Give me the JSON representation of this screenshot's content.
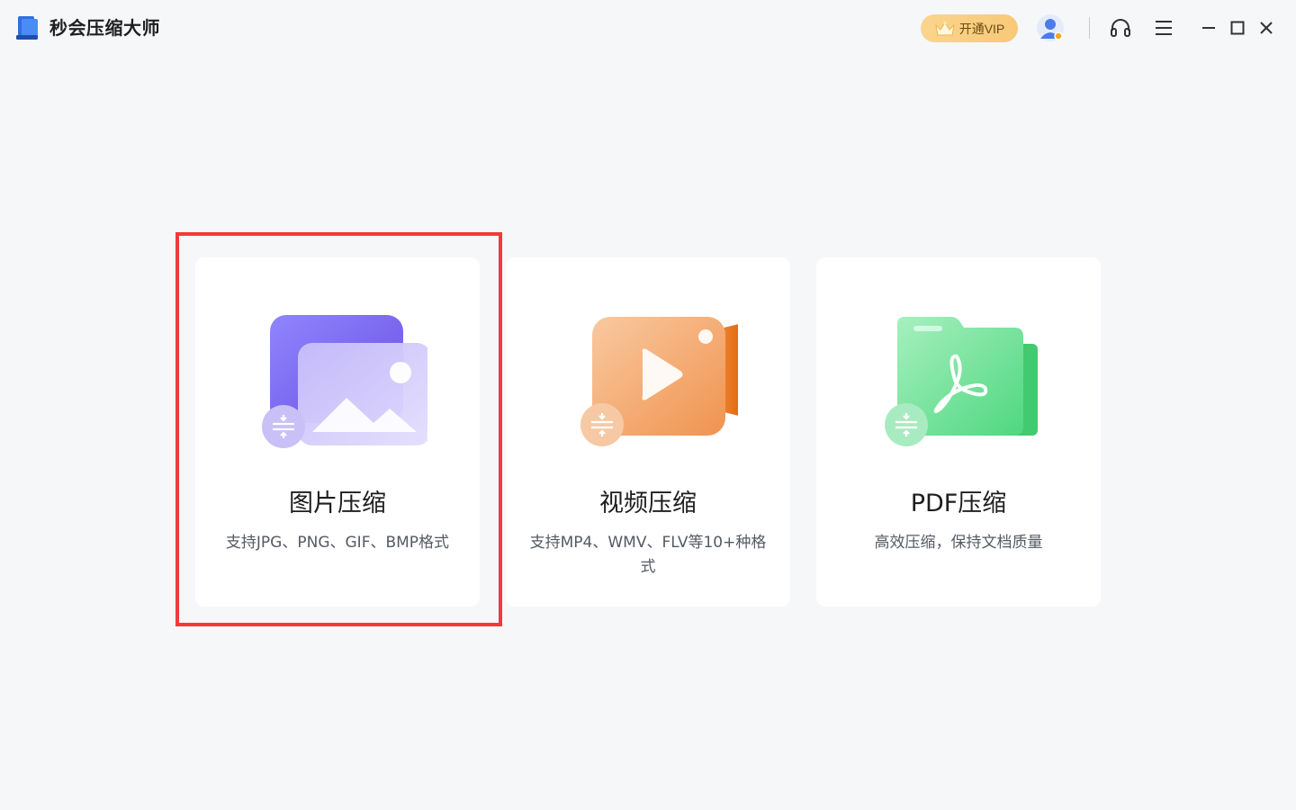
{
  "app": {
    "title": "秒会压缩大师",
    "logo_icon": "app-logo-icon"
  },
  "titlebar": {
    "vip_label": "开通VIP",
    "vip_icon": "crown-icon",
    "avatar_icon": "user-avatar-icon",
    "support_icon": "headset-icon",
    "menu_icon": "hamburger-menu-icon",
    "minimize_icon": "minimize-icon",
    "maximize_icon": "maximize-icon",
    "close_icon": "close-icon"
  },
  "cards": [
    {
      "title": "图片压缩",
      "description": "支持JPG、PNG、GIF、BMP格式",
      "icon": "image-compress-icon",
      "accent": "#8b7cf6",
      "selected": true
    },
    {
      "title": "视频压缩",
      "description": "支持MP4、WMV、FLV等10+种格式",
      "icon": "video-compress-icon",
      "accent": "#f2a15f",
      "selected": false
    },
    {
      "title": "PDF压缩",
      "description": "高效压缩，保持文档质量",
      "icon": "pdf-compress-icon",
      "accent": "#5fd88a",
      "selected": false
    }
  ],
  "colors": {
    "background": "#f6f7f9",
    "card": "#ffffff",
    "highlight": "#f23a3a",
    "vip": "#f8c977"
  }
}
